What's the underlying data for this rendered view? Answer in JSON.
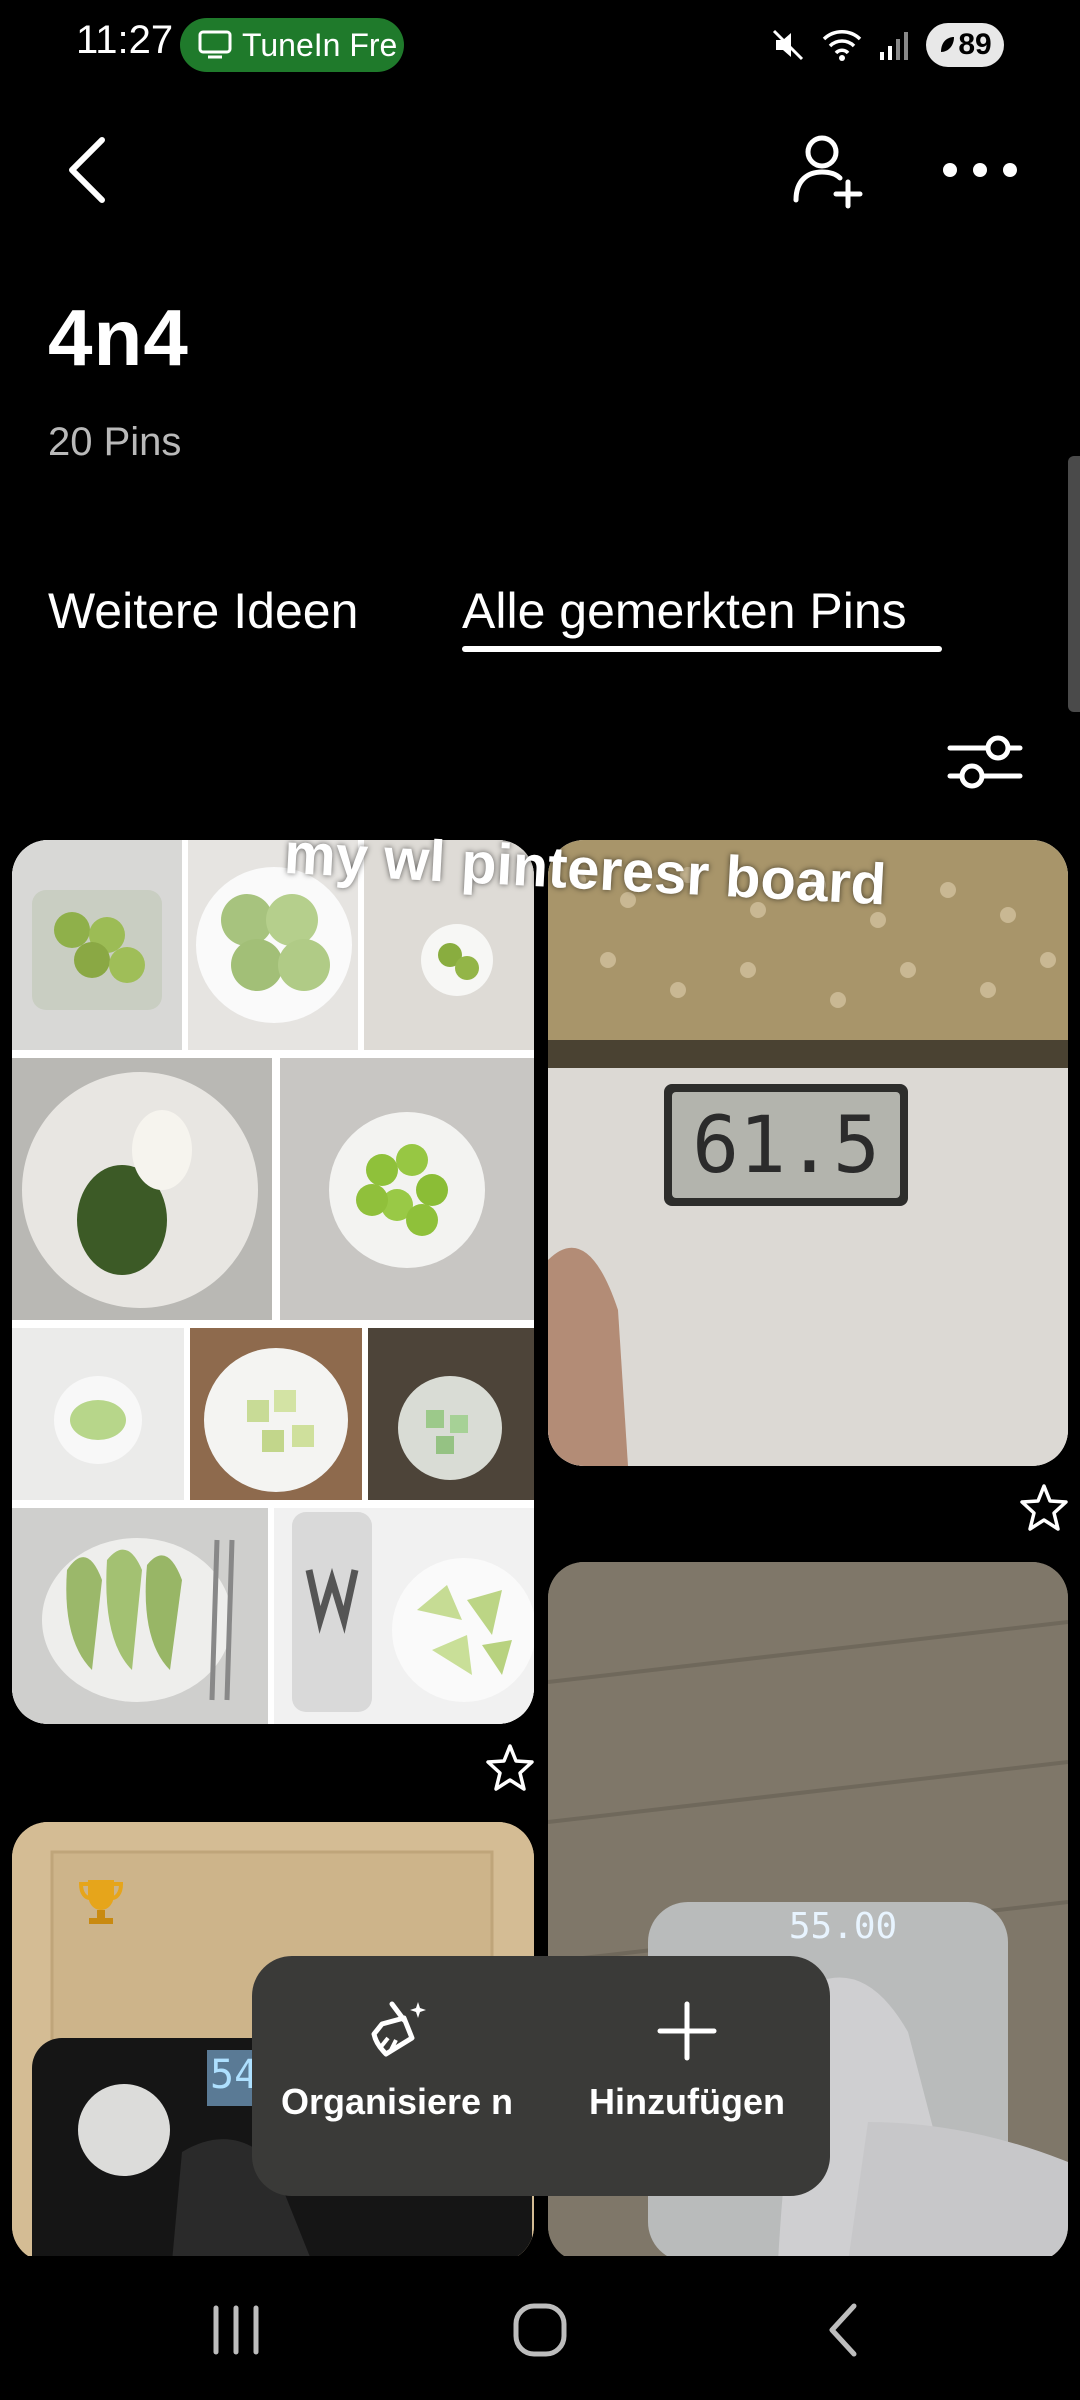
{
  "status_bar": {
    "time": "11:27",
    "notification_pill": "TuneIn Fre",
    "battery": "89"
  },
  "board": {
    "title": "4n4",
    "pin_count": "20 Pins"
  },
  "tabs": [
    {
      "label": "Weitere Ideen",
      "active": false
    },
    {
      "label": "Alle gemerkten Pins",
      "active": true
    }
  ],
  "overlay_text": "my wl pinteresr board",
  "pins": {
    "scale1_display": "61.5",
    "scale2_display": "55.00",
    "scale3_display": "54"
  },
  "action_bar": {
    "organize_label": "Organisiere n",
    "add_label": "Hinzufügen"
  },
  "colors": {
    "background": "#000000",
    "pill_green": "#1f7a2b",
    "action_bar": "#3a3a38"
  }
}
